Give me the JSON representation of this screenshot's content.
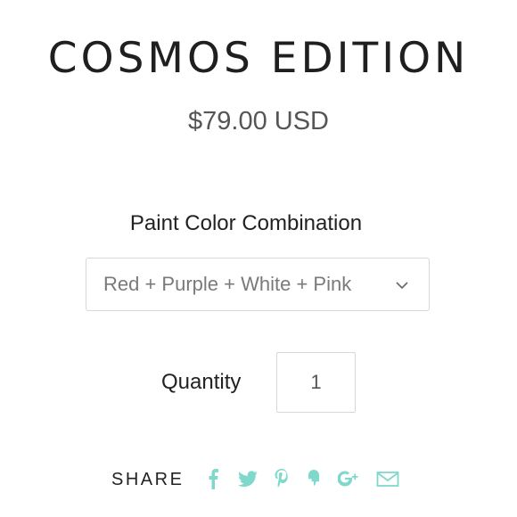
{
  "product": {
    "title": "COSMOS EDITION",
    "price": "$79.00 USD"
  },
  "variant": {
    "label": "Paint Color Combination",
    "selected": "Red + Purple + White + Pink"
  },
  "quantity": {
    "label": "Quantity",
    "value": "1"
  },
  "share": {
    "label": "SHARE",
    "icons": [
      "facebook-icon",
      "twitter-icon",
      "pinterest-icon",
      "fancy-icon",
      "google-plus-icon",
      "email-icon"
    ],
    "icon_color": "#7fd8cc"
  }
}
